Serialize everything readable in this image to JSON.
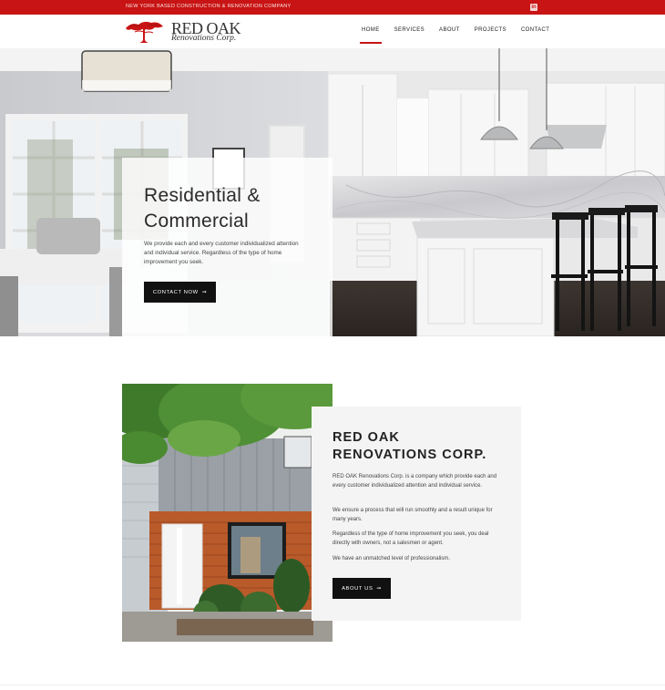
{
  "topbar": {
    "tagline": "NEW YORK BASED CONSTRUCTION & RENOVATION COMPANY",
    "social_icon": "linkedin-icon",
    "social_glyph": "in"
  },
  "brand": {
    "name": "RED OAK",
    "subtitle": "Renovations Corp.",
    "logo_icon": "red-oak-tree-icon",
    "brand_color": "#c81414"
  },
  "nav": {
    "items": [
      {
        "label": "HOME",
        "active": true
      },
      {
        "label": "SERVICES",
        "active": false
      },
      {
        "label": "ABOUT",
        "active": false
      },
      {
        "label": "PROJECTS",
        "active": false
      },
      {
        "label": "CONTACT",
        "active": false
      }
    ]
  },
  "hero": {
    "title_line1": "Residential &",
    "title_line2": "Commercial",
    "text": "We provide each and every customer individualized attention and individual service. Regardless of the type of home improvement you seek.",
    "button_label": "CONTACT NOW",
    "button_icon": "arrow-right-icon"
  },
  "about": {
    "title_line1": "RED OAK",
    "title_line2": "RENOVATIONS CORP.",
    "paragraphs": [
      "RED OAK Renovations Corp. is a company which provide each and every customer individualized attention and individual service.",
      "We ensure a process that will run smoothly and a result unique for many years.",
      "Regardless of the type of home improvement you seek, you deal directly with owners, not a salesmen or agent.",
      "We have an unmatched level of professionalism."
    ],
    "button_label": "ABOUT US",
    "button_icon": "arrow-right-icon"
  }
}
